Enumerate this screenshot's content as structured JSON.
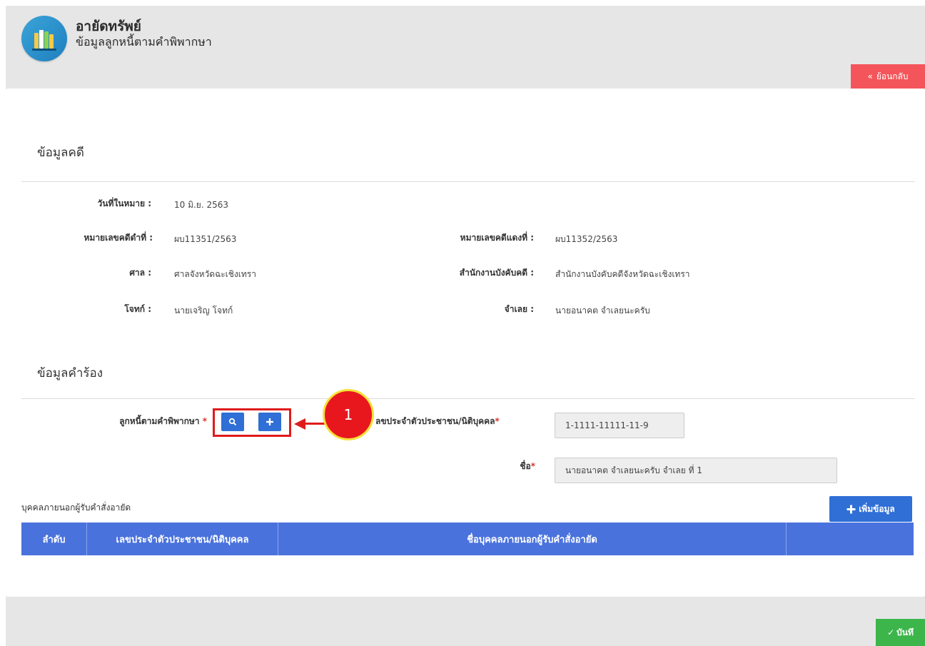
{
  "header": {
    "title": "อายัดทรัพย์",
    "subtitle": "ข้อมูลลูกหนี้ตามคำพิพากษา",
    "back_label": "ย้อนกลับ"
  },
  "case_section": {
    "title": "ข้อมูลคดี",
    "date_label": "วันที่ในหมาย :",
    "date_value": "10 มิ.ย. 2563",
    "black_no_label": "หมายเลขคดีดำที่ :",
    "black_no_value": "ผบ11351/2563",
    "red_no_label": "หมายเลขคดีแดงที่ :",
    "red_no_value": "ผบ11352/2563",
    "court_label": "ศาล :",
    "court_value": "ศาลจังหวัดฉะเชิงเทรา",
    "office_label": "สำนักงานบังคับคดี :",
    "office_value": "สำนักงานบังคับคดีจังหวัดฉะเชิงเทรา",
    "plaintiff_label": "โจทก์ :",
    "plaintiff_value": "นายเจริญ โจทก์",
    "defendant_label": "จำเลย :",
    "defendant_value": "นายอนาคต จำเลยนะครับ"
  },
  "petition_section": {
    "title": "ข้อมูลคำร้อง",
    "debtor_label": "ลูกหนี้ตามคำพิพากษา",
    "required_mark": "*",
    "id_label": "ลขประจำตัวประชาชน/นิติบุคคล",
    "id_value": "1-1111-11111-11-9",
    "name_label": "ชื่อ",
    "name_value": "นายอนาคต จำเลยนะครับ จำเลย ที่ 1",
    "callout_number": "1"
  },
  "third_party": {
    "title": "บุคคลภายนอกผู้รับคำสั่งอายัด",
    "add_label": "เพิ่มข้อมูล",
    "columns": [
      "ลำดับ",
      "เลขประจำตัวประชาชน/นิติบุคคล",
      "ชื่อบุคคลภายนอกผู้รับคำสั่งอายัด",
      ""
    ]
  },
  "footer": {
    "save_label": "บันทึ"
  },
  "colors": {
    "primary": "#2f6fd6",
    "table_header": "#4a72dd",
    "back": "#f4555a",
    "save": "#3cb54a",
    "highlight": "#e01b1b"
  }
}
